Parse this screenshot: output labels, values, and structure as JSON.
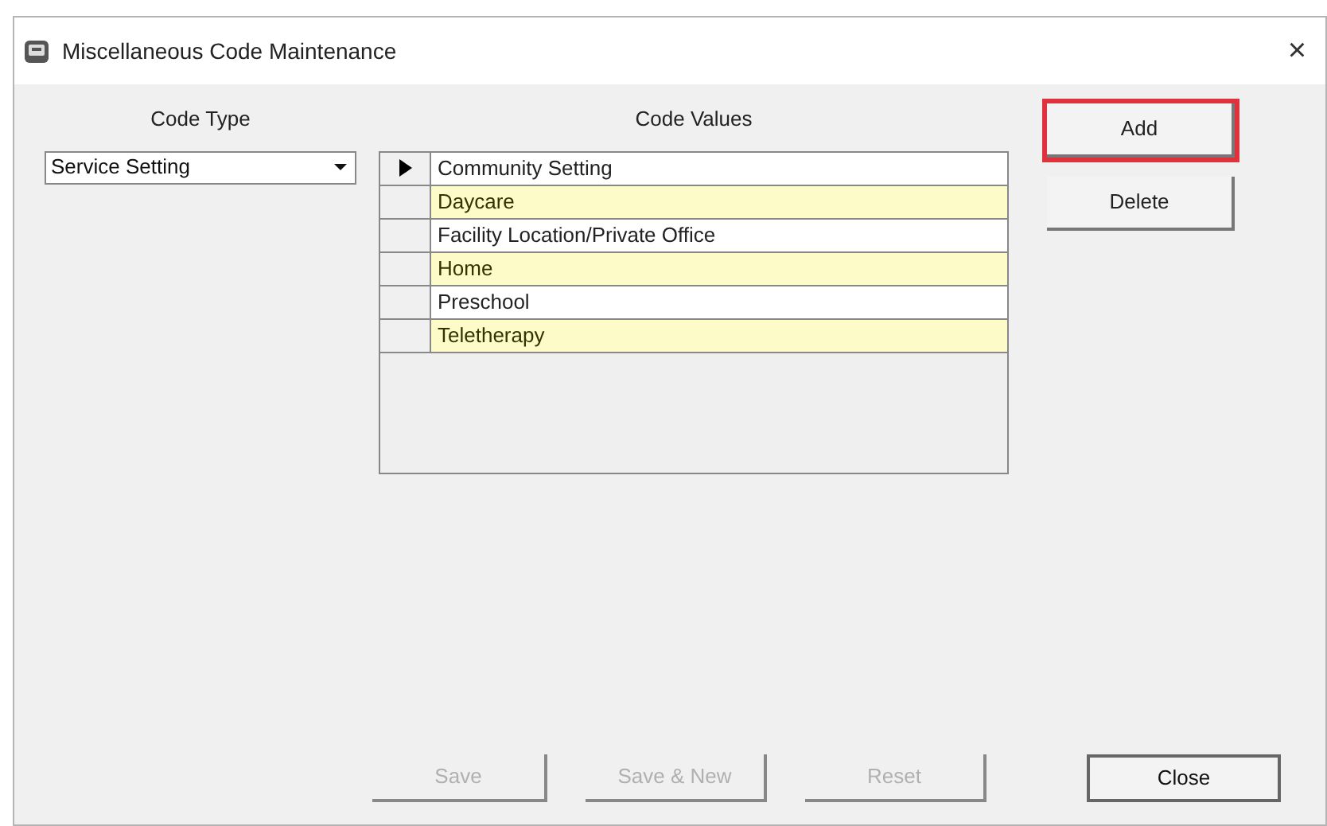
{
  "window": {
    "title": "Miscellaneous Code Maintenance",
    "close": "×"
  },
  "code_type": {
    "label": "Code Type",
    "value": "Service Setting"
  },
  "code_values": {
    "label": "Code Values",
    "rows": [
      {
        "text": "Community Setting",
        "selected": true
      },
      {
        "text": "Daycare",
        "selected": false
      },
      {
        "text": "Facility Location/Private Office",
        "selected": false
      },
      {
        "text": "Home",
        "selected": false
      },
      {
        "text": "Preschool",
        "selected": false
      },
      {
        "text": "Teletherapy",
        "selected": false
      }
    ]
  },
  "side_buttons": [
    {
      "label": "Add",
      "highlighted": true
    },
    {
      "label": "Delete",
      "highlighted": false
    }
  ],
  "bottom_buttons": [
    {
      "label": "Save",
      "disabled": true
    },
    {
      "label": "Save & New",
      "disabled": true
    },
    {
      "label": "Reset",
      "disabled": true
    },
    {
      "label": "Close",
      "disabled": false
    }
  ]
}
